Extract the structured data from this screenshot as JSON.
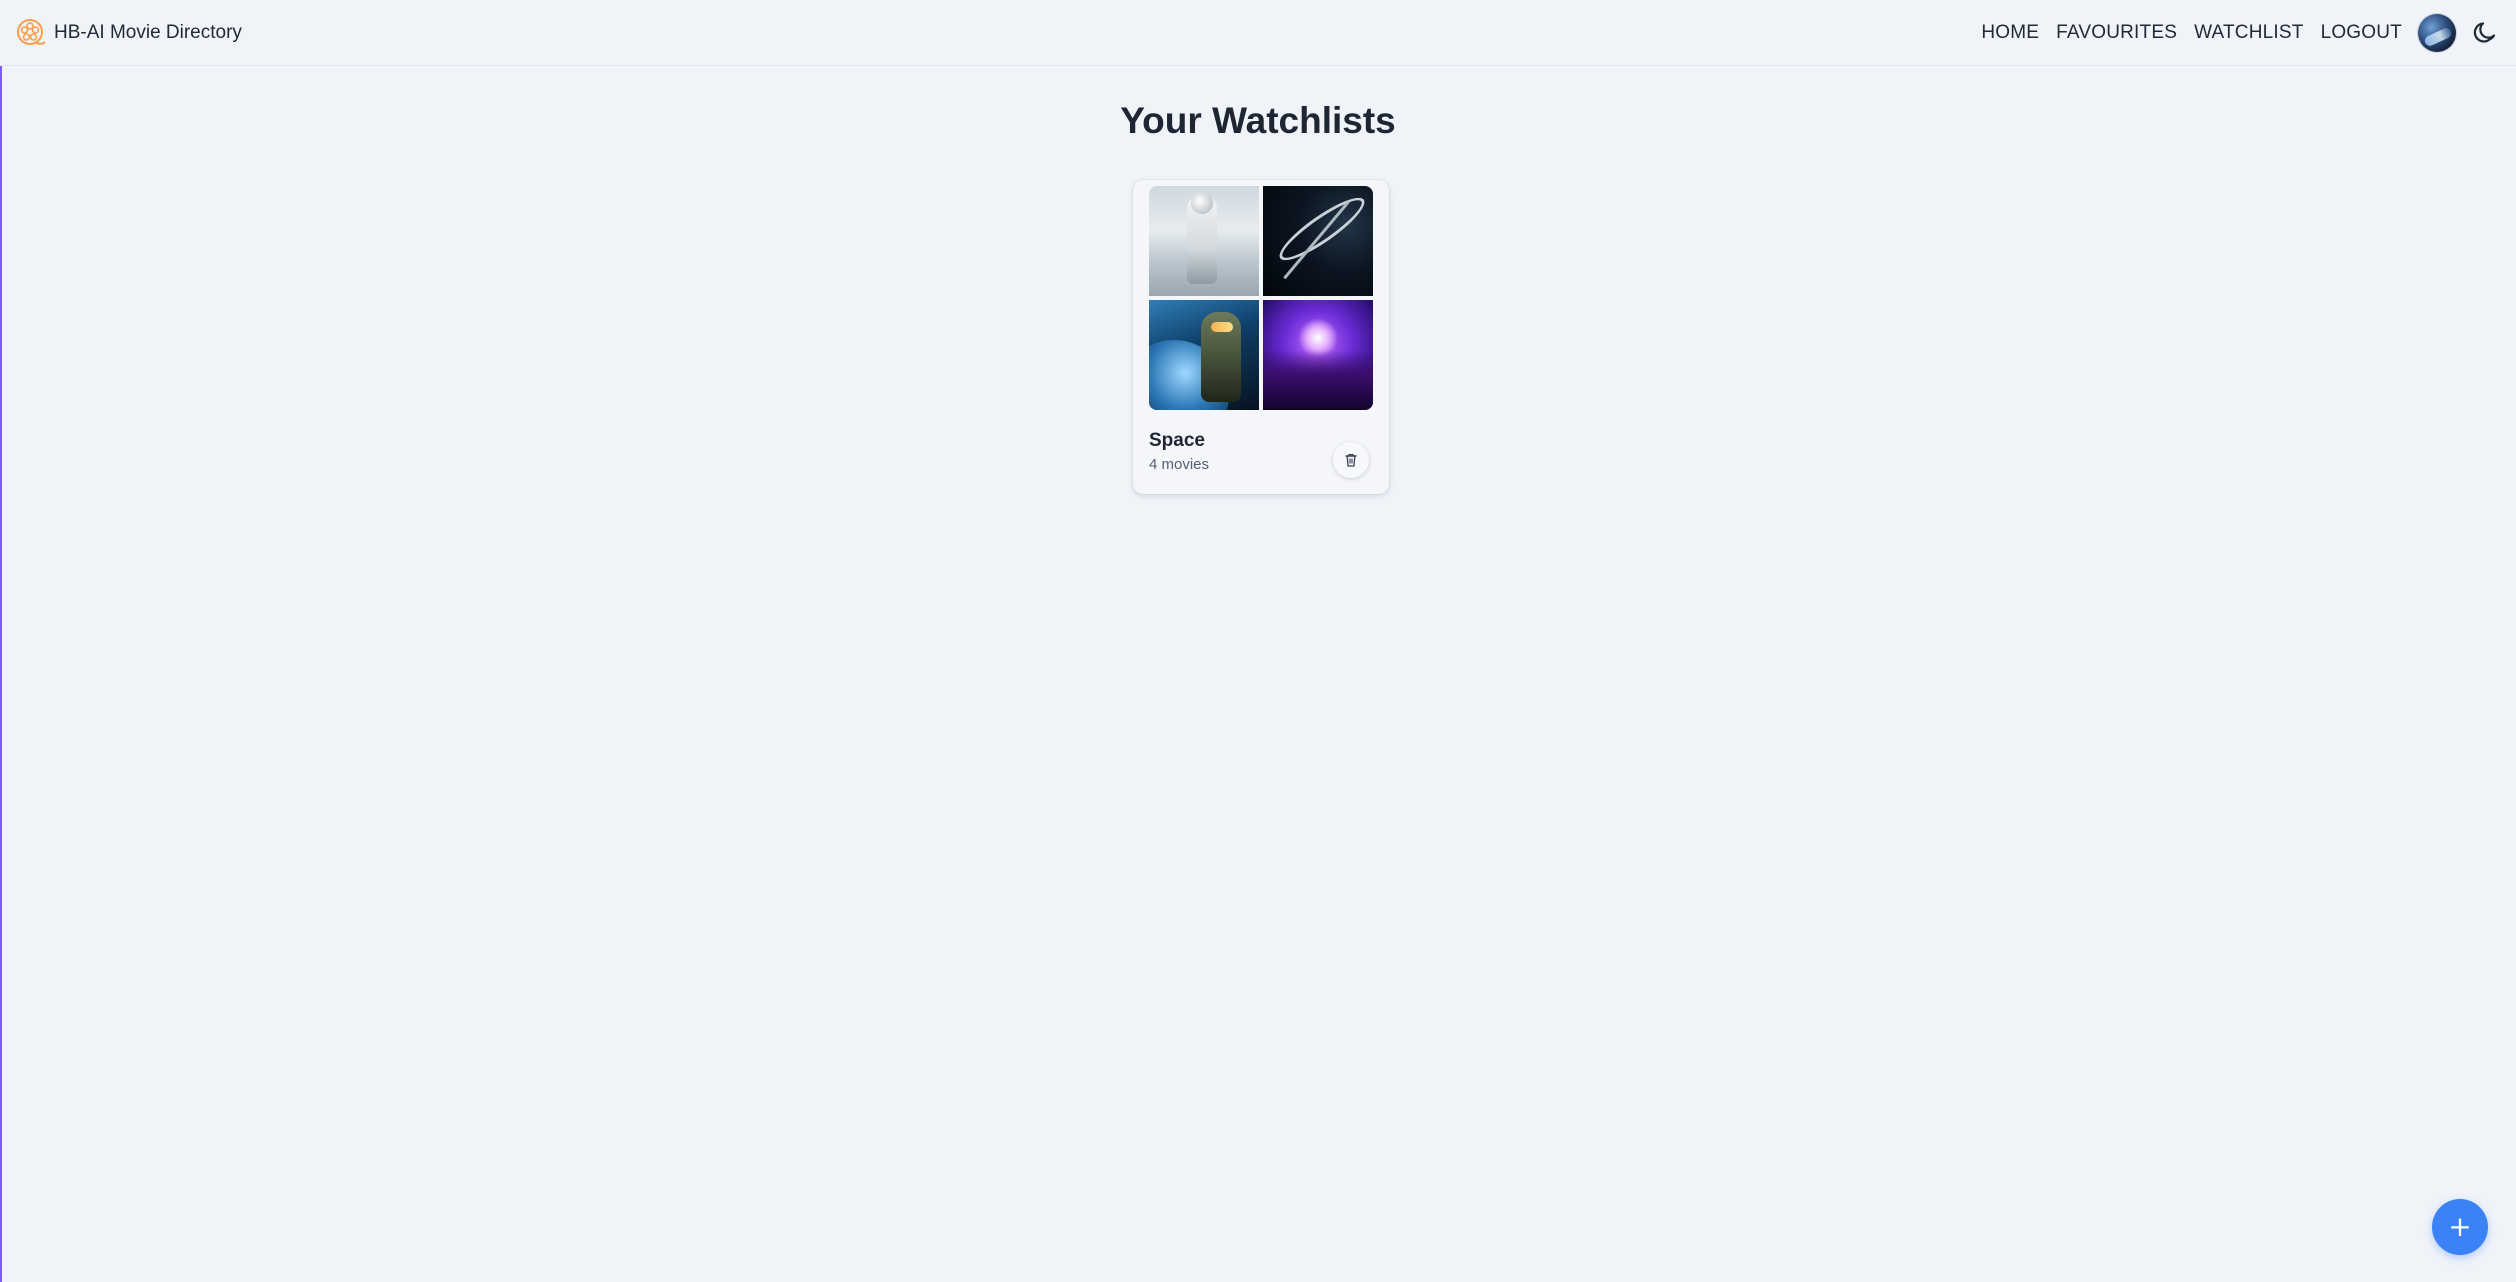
{
  "header": {
    "brand_title": "HB-AI Movie Directory",
    "nav": {
      "home": "HOME",
      "favourites": "FAVOURITES",
      "watchlist": "WATCHLIST",
      "logout": "LOGOUT"
    }
  },
  "main": {
    "title": "Your Watchlists",
    "watchlists": [
      {
        "name": "Space",
        "count_label": "4 movies",
        "posters": [
          "astronaut-poster",
          "space-station-poster",
          "planet-soldier-poster",
          "superhero-ensemble-poster"
        ]
      }
    ]
  },
  "fab": {
    "label": "+"
  },
  "icons": {
    "logo": "film-reel-icon",
    "theme": "moon-icon",
    "delete": "trash-icon",
    "add": "plus-icon"
  },
  "colors": {
    "background": "#f0f3f8",
    "accent": "#3b82f6",
    "logo": "#f6a04d",
    "text": "#1f2937"
  }
}
